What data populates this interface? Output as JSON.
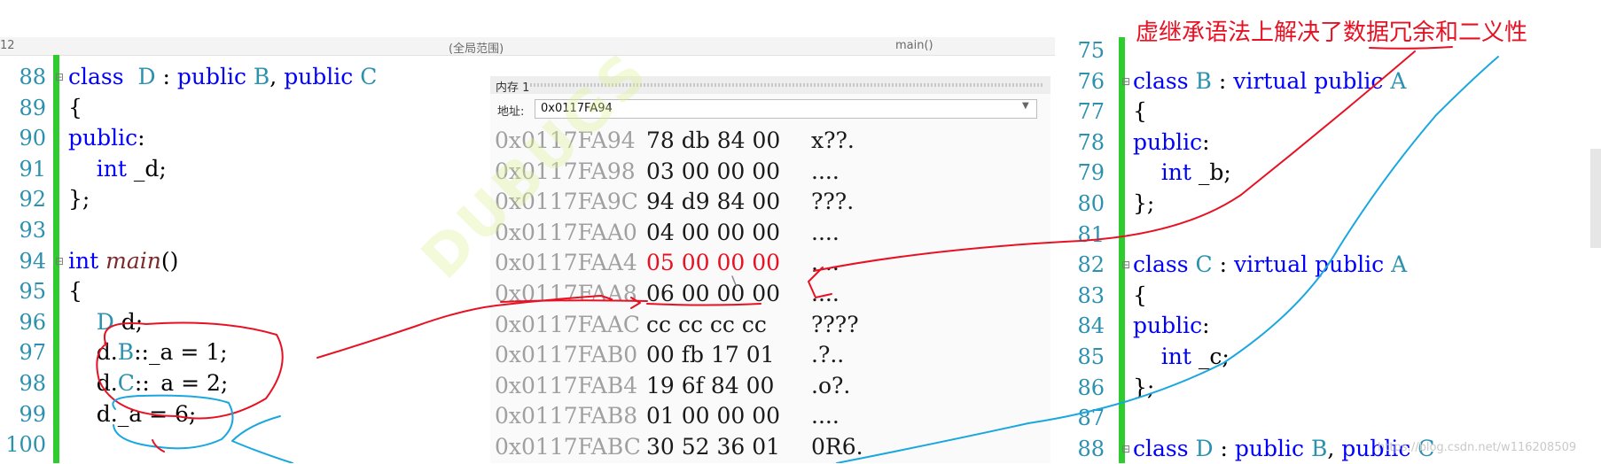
{
  "top_bar": {
    "left": "12",
    "middle": "(全局范围)",
    "right": "main()"
  },
  "annotation": {
    "text": "虚继承语法上解决了数据冗余和二义性"
  },
  "left_code": [
    {
      "line": "88",
      "fold": true,
      "code": [
        [
          "kw",
          "class"
        ],
        [
          "",
          "  "
        ],
        [
          "ty",
          "D"
        ],
        [
          "",
          " : "
        ],
        [
          "kw",
          "public"
        ],
        [
          "",
          " "
        ],
        [
          "ty",
          "B"
        ],
        [
          "",
          ", "
        ],
        [
          "kw",
          "public"
        ],
        [
          "",
          " "
        ],
        [
          "ty",
          "C"
        ]
      ]
    },
    {
      "line": "89",
      "fold": false,
      "code": [
        [
          "",
          "{"
        ]
      ]
    },
    {
      "line": "90",
      "fold": false,
      "code": [
        [
          "kw",
          "public"
        ],
        [
          "",
          ":"
        ]
      ]
    },
    {
      "line": "91",
      "fold": false,
      "code": [
        [
          "",
          "    "
        ],
        [
          "kw",
          "int"
        ],
        [
          "",
          " _d;"
        ]
      ]
    },
    {
      "line": "92",
      "fold": false,
      "code": [
        [
          "",
          "};"
        ]
      ]
    },
    {
      "line": "93",
      "fold": false,
      "code": []
    },
    {
      "line": "94",
      "fold": true,
      "code": [
        [
          "kw",
          "int"
        ],
        [
          "",
          " "
        ],
        [
          "it",
          "main"
        ],
        [
          "",
          "()"
        ]
      ]
    },
    {
      "line": "95",
      "fold": false,
      "code": [
        [
          "",
          "{"
        ]
      ]
    },
    {
      "line": "96",
      "fold": false,
      "code": [
        [
          "",
          "    "
        ],
        [
          "ty",
          "D"
        ],
        [
          "",
          " d;"
        ]
      ]
    },
    {
      "line": "97",
      "fold": false,
      "code": [
        [
          "",
          "    d."
        ],
        [
          "ty",
          "B"
        ],
        [
          "",
          "::_a = 1;"
        ]
      ]
    },
    {
      "line": "98",
      "fold": false,
      "code": [
        [
          "",
          "    d."
        ],
        [
          "ty",
          "C"
        ],
        [
          "",
          "::_a = 2;"
        ]
      ]
    },
    {
      "line": "99",
      "fold": false,
      "code": [
        [
          "",
          "    d._a = 6;"
        ]
      ]
    },
    {
      "line": "100",
      "fold": false,
      "code": []
    }
  ],
  "memory": {
    "title": "内存 1",
    "address_label": "地址:",
    "address_value": "0x0117FA94",
    "rows": [
      {
        "addr": "0x0117FA94",
        "bytes": "78 db 84 00",
        "chars": "x??."
      },
      {
        "addr": "0x0117FA98",
        "bytes": "03 00 00 00",
        "chars": "...."
      },
      {
        "addr": "0x0117FA9C",
        "bytes": "94 d9 84 00",
        "chars": "???."
      },
      {
        "addr": "0x0117FAA0",
        "bytes": "04 00 00 00",
        "chars": "...."
      },
      {
        "addr": "0x0117FAA4",
        "bytes": "05 00 00 00",
        "chars": "....",
        "highlight": true
      },
      {
        "addr": "0x0117FAA8",
        "bytes": "06 00 00 00",
        "chars": "...."
      },
      {
        "addr": "0x0117FAAC",
        "bytes": "cc cc cc cc",
        "chars": "????"
      },
      {
        "addr": "0x0117FAB0",
        "bytes": "00 fb 17 01",
        "chars": ".?.."
      },
      {
        "addr": "0x0117FAB4",
        "bytes": "19 6f 84 00",
        "chars": ".o?."
      },
      {
        "addr": "0x0117FAB8",
        "bytes": "01 00 00 00",
        "chars": "...."
      },
      {
        "addr": "0x0117FABC",
        "bytes": "30 52 36 01",
        "chars": "0R6."
      }
    ],
    "highlight_color": "#e81123"
  },
  "right_code": [
    {
      "line": "75",
      "fold": false,
      "code": []
    },
    {
      "line": "76",
      "fold": true,
      "code": [
        [
          "kw",
          "class"
        ],
        [
          "",
          " "
        ],
        [
          "ty",
          "B"
        ],
        [
          "",
          " : "
        ],
        [
          "kw",
          "virtual"
        ],
        [
          "",
          " "
        ],
        [
          "kw",
          "public"
        ],
        [
          "",
          " "
        ],
        [
          "ty",
          "A"
        ]
      ]
    },
    {
      "line": "77",
      "fold": false,
      "code": [
        [
          "",
          "{"
        ]
      ]
    },
    {
      "line": "78",
      "fold": false,
      "code": [
        [
          "kw",
          "public"
        ],
        [
          "",
          ":"
        ]
      ]
    },
    {
      "line": "79",
      "fold": false,
      "code": [
        [
          "",
          "    "
        ],
        [
          "kw",
          "int"
        ],
        [
          "",
          " _b;"
        ]
      ]
    },
    {
      "line": "80",
      "fold": false,
      "code": [
        [
          "",
          "};"
        ]
      ]
    },
    {
      "line": "81",
      "fold": false,
      "code": []
    },
    {
      "line": "82",
      "fold": true,
      "code": [
        [
          "kw",
          "class"
        ],
        [
          "",
          " "
        ],
        [
          "ty",
          "C"
        ],
        [
          "",
          " : "
        ],
        [
          "kw",
          "virtual"
        ],
        [
          "",
          " "
        ],
        [
          "kw",
          "public"
        ],
        [
          "",
          " "
        ],
        [
          "ty",
          "A"
        ]
      ]
    },
    {
      "line": "83",
      "fold": false,
      "code": [
        [
          "",
          "{"
        ]
      ]
    },
    {
      "line": "84",
      "fold": false,
      "code": [
        [
          "kw",
          "public"
        ],
        [
          "",
          ":"
        ]
      ]
    },
    {
      "line": "85",
      "fold": false,
      "code": [
        [
          "",
          "    "
        ],
        [
          "kw",
          "int"
        ],
        [
          "",
          " _c;"
        ]
      ]
    },
    {
      "line": "86",
      "fold": false,
      "code": [
        [
          "",
          "};"
        ]
      ]
    },
    {
      "line": "87",
      "fold": false,
      "code": []
    },
    {
      "line": "88",
      "fold": true,
      "code": [
        [
          "kw",
          "class"
        ],
        [
          "",
          " "
        ],
        [
          "ty",
          "D"
        ],
        [
          "",
          " : "
        ],
        [
          "kw",
          "public"
        ],
        [
          "",
          " "
        ],
        [
          "ty",
          "B"
        ],
        [
          "",
          ", "
        ],
        [
          "kw",
          "public"
        ],
        [
          "",
          " "
        ],
        [
          "ty",
          "C"
        ]
      ]
    }
  ],
  "watermark": "DUBUGS",
  "credit": "https://blog.csdn.net/w116208509",
  "colors": {
    "gutter_green": "#2ecc2e",
    "annotation_red": "#e81123",
    "annotation_blue": "#1aa7e0",
    "line_number": "#2b91af",
    "keyword": "#0000ff"
  }
}
